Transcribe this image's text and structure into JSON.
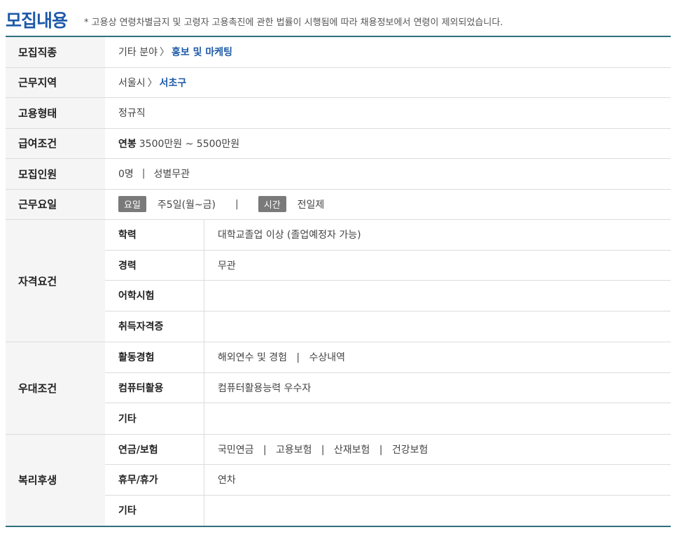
{
  "header": {
    "title": "모집내용",
    "notice": "* 고용상 연령차별금지 및 고령자 고용촉진에 관한 법률이 시행됨에 따라 채용정보에서 연령이 제외되었습니다."
  },
  "rows": {
    "job": {
      "label": "모집직종",
      "category": "기타 분야",
      "separator": "〉",
      "value": "홍보 및 마케팅"
    },
    "region": {
      "label": "근무지역",
      "city": "서울시",
      "separator": "〉",
      "district": "서초구"
    },
    "employment": {
      "label": "고용형태",
      "value": "정규직"
    },
    "salary": {
      "label": "급여조건",
      "type": "연봉",
      "value": "3500만원 ~ 5500만원"
    },
    "headcount": {
      "label": "모집인원",
      "count": "0명",
      "divider": "|",
      "gender": "성별무관"
    },
    "schedule": {
      "label": "근무요일",
      "day_tag": "요일",
      "days": "주5일(월~금)",
      "divider": "|",
      "time_tag": "시간",
      "time": "전일제"
    }
  },
  "qualifications": {
    "label": "자격요건",
    "items": [
      {
        "label": "학력",
        "value": "대학교졸업 이상 (졸업예정자 가능)"
      },
      {
        "label": "경력",
        "value": "무관"
      },
      {
        "label": "어학시험",
        "value": ""
      },
      {
        "label": "취득자격증",
        "value": ""
      }
    ]
  },
  "preferences": {
    "label": "우대조건",
    "items": [
      {
        "label": "활동경험",
        "value": "해외연수 및 경험   |   수상내역"
      },
      {
        "label": "컴퓨터활용",
        "value": "컴퓨터활용능력 우수자"
      },
      {
        "label": "기타",
        "value": ""
      }
    ]
  },
  "benefits": {
    "label": "복리후생",
    "items": [
      {
        "label": "연금/보험",
        "value": "국민연금   |   고용보험   |   산재보험   |   건강보험"
      },
      {
        "label": "휴무/휴가",
        "value": "연차"
      },
      {
        "label": "기타",
        "value": ""
      }
    ]
  }
}
